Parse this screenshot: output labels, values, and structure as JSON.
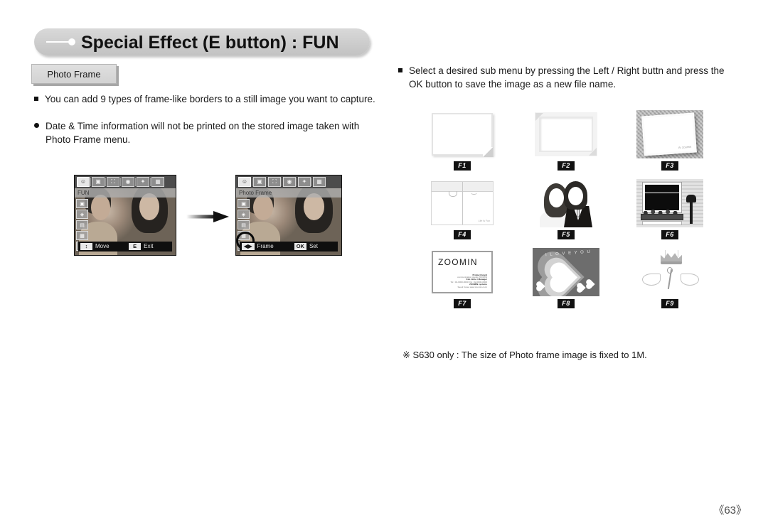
{
  "header": {
    "title": "Special Effect (E button) :  FUN",
    "section_tab": "Photo Frame"
  },
  "left_column": {
    "bullets": [
      {
        "marker": "square",
        "text": "You can add 9 types of frame-like borders to a still image you want to capture."
      },
      {
        "marker": "dot",
        "text": "Date & Time information will not be printed on the stored image taken with Photo Frame menu."
      }
    ],
    "camera_screens": [
      {
        "id": "screen-fun",
        "menu_title": "FUN",
        "top_icons": [
          "smiley-icon",
          "image-edit-icon",
          "camera-icon",
          "palette-icon",
          "star-wand-icon",
          "film-strip-icon"
        ],
        "active_top_icon_index": 0,
        "side_icons": [
          "effect-icon-1",
          "effect-icon-2",
          "effect-icon-3",
          "effect-icon-4",
          "effect-icon-5"
        ],
        "bottom_bar": {
          "nav_key": "↕",
          "nav_label": "Move",
          "action_key": "E",
          "action_label": "Exit"
        }
      },
      {
        "id": "screen-photo-frame",
        "menu_title": "Photo Frame",
        "top_icons": [
          "smiley-icon",
          "image-edit-icon",
          "camera-icon",
          "palette-icon",
          "star-wand-icon",
          "film-strip-icon"
        ],
        "active_top_icon_index": 0,
        "side_icons": [
          "effect-icon-1",
          "effect-icon-2",
          "effect-icon-3",
          "effect-icon-4",
          "effect-icon-5"
        ],
        "highlighted_side_icon_index": 3,
        "bottom_bar": {
          "nav_key": "◀▶",
          "nav_label": "Frame",
          "action_key": "OK",
          "action_label": "Set"
        }
      }
    ],
    "flow_arrow": "right-arrow-icon"
  },
  "right_column": {
    "bullets": [
      {
        "marker": "square",
        "text": "Select a desired sub menu by pressing the Left / Right buttn and press the OK button to save the image as a new file name."
      }
    ],
    "frames": [
      {
        "tag": "F1",
        "name": "plain-folded-corner-frame",
        "caption": ""
      },
      {
        "tag": "F2",
        "name": "inset-bevel-frame",
        "caption": ""
      },
      {
        "tag": "F3",
        "name": "tilted-polaroid-frame",
        "caption": "Ar Zoomin"
      },
      {
        "tag": "F4",
        "name": "notebook-page-frame",
        "caption": "Life Is Fun"
      },
      {
        "tag": "F5",
        "name": "wedding-couple-frame",
        "caption": ""
      },
      {
        "tag": "F6",
        "name": "window-mailbox-frame",
        "caption": ""
      },
      {
        "tag": "F7",
        "name": "zoomin-card-frame",
        "caption": "ZOOMIN",
        "card_lines": [
          "Product brand",
          "communication studio ZOOMIN",
          "Kim Jinho / Manager",
          "Tel : 02-0000-0000  F/A : 02-0000-0000",
          "ZOOMIN systems",
          "Seoul Korea www.zoomin.co.kr"
        ]
      },
      {
        "tag": "F8",
        "name": "heart-frame",
        "caption": "I L O V E Y O U"
      },
      {
        "tag": "F9",
        "name": "crown-wings-frame",
        "caption": ""
      }
    ],
    "footnote": "※ S630 only : The size of Photo frame image is fixed to 1M."
  },
  "footer": {
    "page_number": "《63》"
  }
}
